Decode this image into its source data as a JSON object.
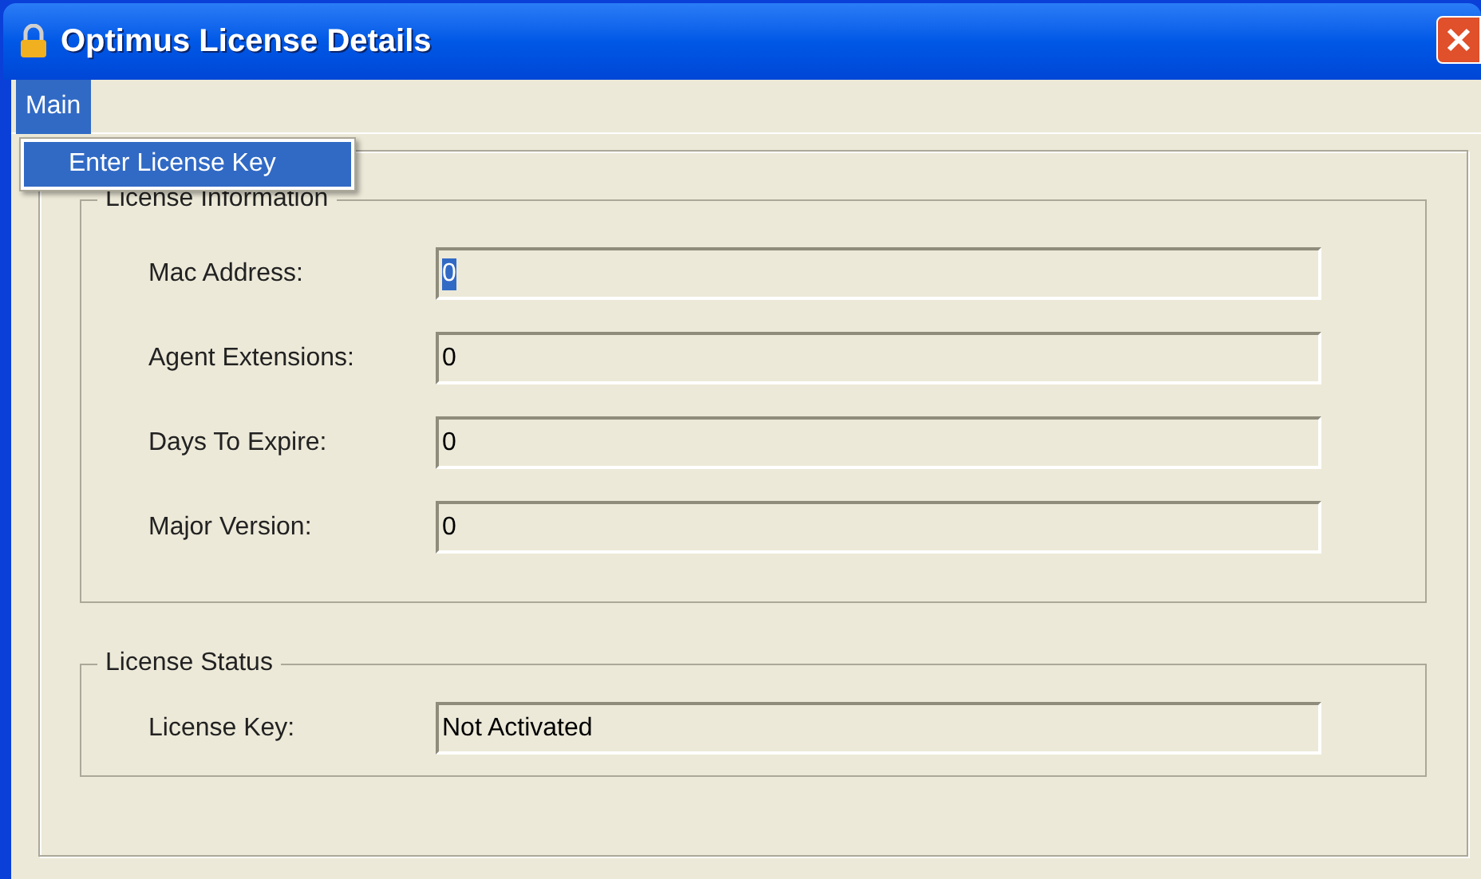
{
  "window": {
    "title": "Optimus License Details"
  },
  "menu_bar": [
    {
      "label": "Main",
      "selected": true
    }
  ],
  "dropdown": [
    {
      "label": "Enter License Key",
      "selected": true
    }
  ],
  "license_information": {
    "title": "License Information",
    "fields": [
      {
        "label": "Mac Address:",
        "value": "0",
        "highlighted": true
      },
      {
        "label": "Agent Extensions:",
        "value": "0",
        "highlighted": false
      },
      {
        "label": "Days To Expire:",
        "value": "0",
        "highlighted": false
      },
      {
        "label": "Major Version:",
        "value": "0",
        "highlighted": false
      }
    ]
  },
  "license_status": {
    "title": "License Status",
    "fields": [
      {
        "label": "License Key:",
        "value": "Not Activated",
        "highlighted": false
      }
    ]
  }
}
